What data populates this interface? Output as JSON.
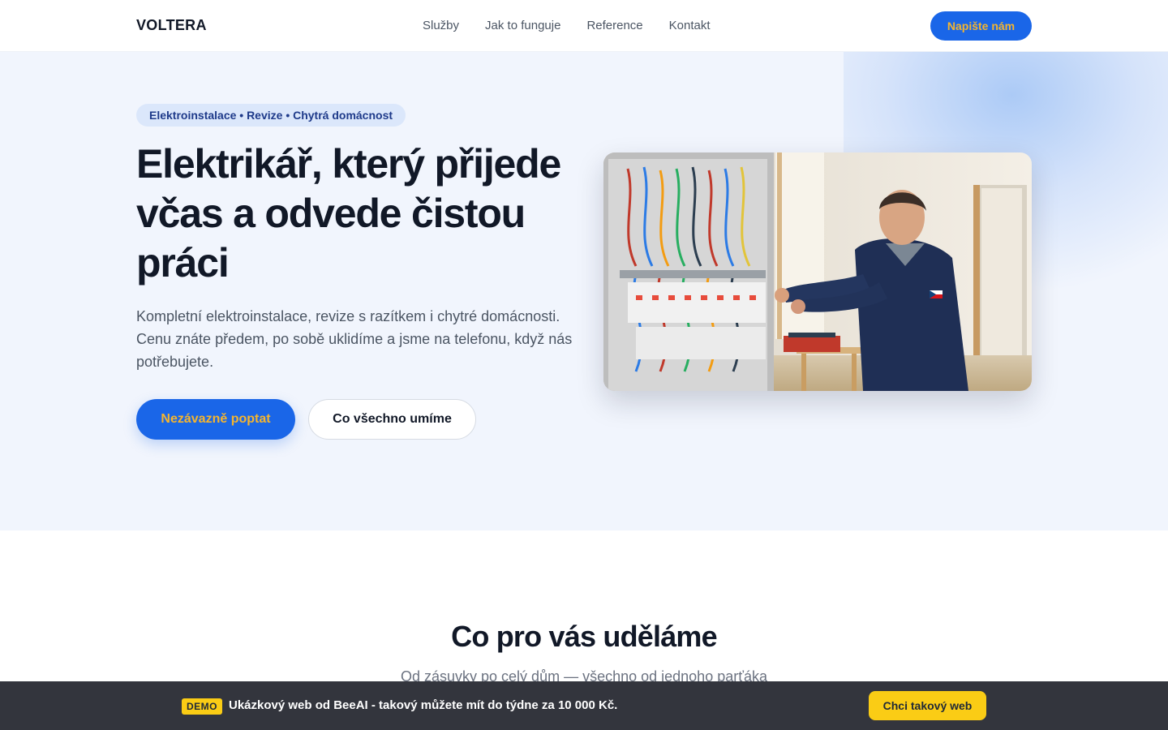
{
  "header": {
    "logo": "VOLTERA",
    "nav": [
      {
        "label": "Služby"
      },
      {
        "label": "Jak to funguje"
      },
      {
        "label": "Reference"
      },
      {
        "label": "Kontakt"
      }
    ],
    "cta_label": "Napište nám"
  },
  "hero": {
    "badge": "Elektroinstalace • Revize • Chytrá domácnost",
    "title": "Elektrikář, který přijede včas a odvede čistou práci",
    "text": "Kompletní elektroinstalace, revize s razítkem i chytré domácnosti. Cenu znáte předem, po sobě uklidíme a jsme na telefonu, když nás potřebujete.",
    "primary_button": "Nezávazně poptat",
    "secondary_button": "Co všechno umíme",
    "photo_icon": "electrician-photo"
  },
  "services": {
    "title": "Co pro vás uděláme",
    "subtitle": "Od zásuvky po celý dům — všechno od jednoho parťáka"
  },
  "demo_bar": {
    "tag": "DEMO",
    "text": "Ukázkový web od BeeAI - takový můžete mít do týdne za 10 000 Kč.",
    "cta": "Chci takový web"
  },
  "colors": {
    "accent": "#1a66e8",
    "accent_text": "#f5b52e",
    "hero_bg": "#f1f5fd",
    "demo_bg": "#33353d",
    "demo_accent": "#facc15"
  }
}
